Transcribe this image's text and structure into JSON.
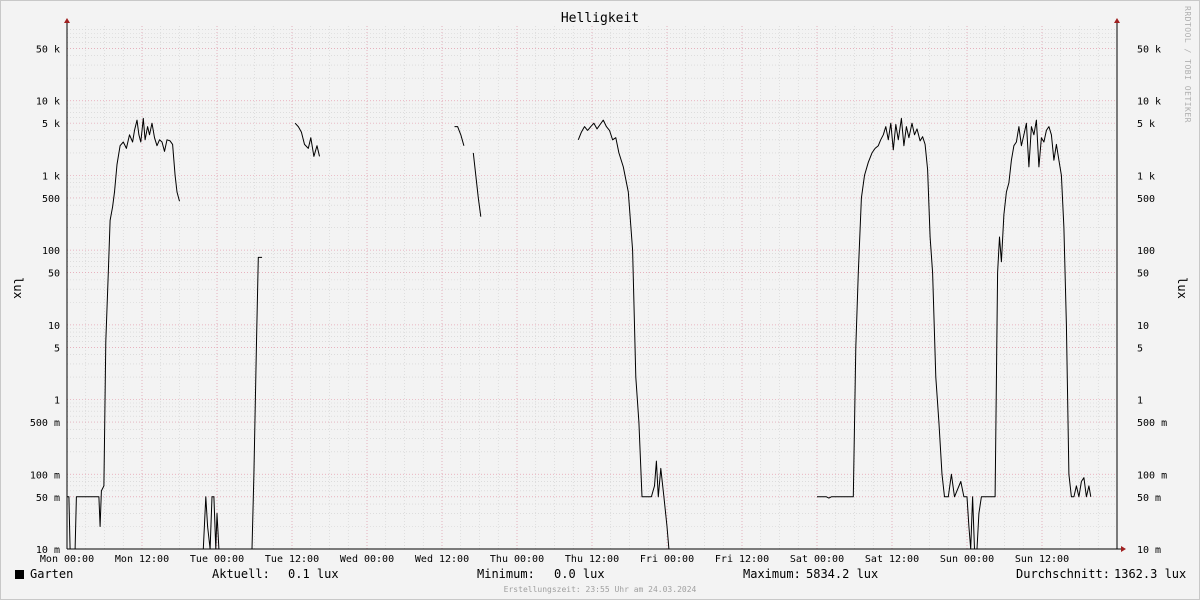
{
  "watermark": "RRDTOOL / TOBI OETIKER",
  "legend": {
    "series_name": "Garten",
    "current_label": "Aktuell:",
    "current_value": "0.1 lux",
    "min_label": "Minimum:",
    "min_value": "0.0 lux",
    "max_label": "Maximum:",
    "max_value": "5834.2 lux",
    "avg_label": "Durchschnitt:",
    "avg_value": "1362.3 lux"
  },
  "footer": "Erstellungszeit: 23:55 Uhr am 24.03.2024",
  "colors": {
    "grid_major": "#e6a0b0",
    "grid_minor": "#d0d0d0",
    "line": "#000000",
    "axis_arrow": "#a02020"
  },
  "chart_data": {
    "type": "line",
    "title": "Helligkeit",
    "ylabel": "lux",
    "ylabel_right": "lux",
    "yscale": "log",
    "ylim": [
      0.01,
      100000
    ],
    "xlim_hours": [
      0,
      168
    ],
    "y_ticks": [
      {
        "value": 0.01,
        "label": "10 m"
      },
      {
        "value": 0.05,
        "label": "50 m"
      },
      {
        "value": 0.1,
        "label": "100 m"
      },
      {
        "value": 0.5,
        "label": "500 m"
      },
      {
        "value": 1,
        "label": "1"
      },
      {
        "value": 5,
        "label": "5"
      },
      {
        "value": 10,
        "label": "10"
      },
      {
        "value": 50,
        "label": "50"
      },
      {
        "value": 100,
        "label": "100"
      },
      {
        "value": 500,
        "label": "500"
      },
      {
        "value": 1000,
        "label": "1 k"
      },
      {
        "value": 5000,
        "label": "5 k"
      },
      {
        "value": 10000,
        "label": "10 k"
      },
      {
        "value": 50000,
        "label": "50 k"
      }
    ],
    "x_ticks": [
      {
        "hour": 0,
        "label": "Mon 00:00"
      },
      {
        "hour": 12,
        "label": "Mon 12:00"
      },
      {
        "hour": 24,
        "label": "Tue 00:00"
      },
      {
        "hour": 36,
        "label": "Tue 12:00"
      },
      {
        "hour": 48,
        "label": "Wed 00:00"
      },
      {
        "hour": 60,
        "label": "Wed 12:00"
      },
      {
        "hour": 72,
        "label": "Thu 00:00"
      },
      {
        "hour": 84,
        "label": "Thu 12:00"
      },
      {
        "hour": 96,
        "label": "Fri 00:00"
      },
      {
        "hour": 108,
        "label": "Fri 12:00"
      },
      {
        "hour": 120,
        "label": "Sat 00:00"
      },
      {
        "hour": 132,
        "label": "Sat 12:00"
      },
      {
        "hour": 144,
        "label": "Sun 00:00"
      },
      {
        "hour": 156,
        "label": "Sun 12:00"
      }
    ],
    "series": [
      {
        "segments": [
          [
            [
              0.0,
              0.05
            ],
            [
              0.3,
              0.05
            ],
            [
              0.5,
              0.01
            ],
            [
              1.3,
              0.01
            ],
            [
              1.5,
              0.05
            ],
            [
              5.1,
              0.05
            ],
            [
              5.3,
              0.02
            ],
            [
              5.5,
              0.06
            ],
            [
              5.9,
              0.07
            ],
            [
              6.2,
              6
            ],
            [
              6.6,
              50
            ],
            [
              6.9,
              250
            ],
            [
              7.3,
              380
            ],
            [
              7.6,
              600
            ],
            [
              8.0,
              1400
            ],
            [
              8.5,
              2500
            ],
            [
              9.0,
              2800
            ],
            [
              9.5,
              2300
            ],
            [
              10.0,
              3500
            ],
            [
              10.5,
              2800
            ],
            [
              10.8,
              4000
            ],
            [
              11.2,
              5500
            ],
            [
              11.5,
              3500
            ],
            [
              11.8,
              2800
            ],
            [
              12.2,
              5800
            ],
            [
              12.5,
              3000
            ],
            [
              12.9,
              4500
            ],
            [
              13.2,
              3500
            ],
            [
              13.6,
              5000
            ],
            [
              14.0,
              3200
            ],
            [
              14.4,
              2500
            ],
            [
              14.8,
              3000
            ],
            [
              15.2,
              2800
            ],
            [
              15.6,
              2100
            ],
            [
              16.0,
              3000
            ],
            [
              16.5,
              2900
            ],
            [
              16.9,
              2600
            ],
            [
              17.3,
              1000
            ],
            [
              17.6,
              600
            ],
            [
              18.0,
              450
            ]
          ],
          [
            [
              21.8,
              0.01
            ],
            [
              22.2,
              0.05
            ],
            [
              22.5,
              0.02
            ],
            [
              22.9,
              0.01
            ],
            [
              23.2,
              0.05
            ],
            [
              23.5,
              0.05
            ],
            [
              23.8,
              0.01
            ],
            [
              24.0,
              0.03
            ],
            [
              24.3,
              0.01
            ],
            [
              29.6,
              0.01
            ],
            [
              29.9,
              0.1
            ],
            [
              30.3,
              5
            ],
            [
              30.6,
              80
            ],
            [
              31.2,
              80
            ]
          ],
          [
            [
              36.5,
              5000
            ],
            [
              37.0,
              4500
            ],
            [
              37.5,
              3800
            ],
            [
              38.0,
              2600
            ],
            [
              38.6,
              2300
            ],
            [
              39.0,
              3200
            ],
            [
              39.5,
              1800
            ],
            [
              40.0,
              2500
            ],
            [
              40.4,
              1800
            ]
          ],
          [
            [
              62.0,
              4500
            ],
            [
              62.5,
              4500
            ],
            [
              63.0,
              3500
            ],
            [
              63.5,
              2500
            ]
          ],
          [
            [
              65.0,
              2000
            ],
            [
              65.4,
              1000
            ],
            [
              65.8,
              500
            ],
            [
              66.2,
              280
            ]
          ],
          [
            [
              81.8,
              3000
            ],
            [
              82.3,
              3800
            ],
            [
              82.8,
              4500
            ],
            [
              83.3,
              4000
            ],
            [
              83.8,
              4500
            ],
            [
              84.3,
              5000
            ],
            [
              84.8,
              4200
            ],
            [
              85.3,
              4800
            ],
            [
              85.8,
              5500
            ],
            [
              86.3,
              4500
            ],
            [
              86.8,
              4000
            ],
            [
              87.3,
              3000
            ],
            [
              87.8,
              3200
            ],
            [
              88.3,
              2000
            ],
            [
              89.0,
              1300
            ],
            [
              89.8,
              600
            ],
            [
              90.5,
              100
            ],
            [
              91.0,
              2
            ],
            [
              91.5,
              0.5
            ],
            [
              92.0,
              0.05
            ],
            [
              93.5,
              0.05
            ],
            [
              94.0,
              0.07
            ],
            [
              94.3,
              0.15
            ],
            [
              94.6,
              0.05
            ],
            [
              95.0,
              0.12
            ],
            [
              95.5,
              0.05
            ],
            [
              96.0,
              0.02
            ],
            [
              96.3,
              0.01
            ]
          ],
          [
            [
              120.0,
              0.05
            ],
            [
              121.5,
              0.05
            ],
            [
              121.9,
              0.048
            ],
            [
              122.3,
              0.05
            ],
            [
              125.8,
              0.05
            ],
            [
              126.2,
              5
            ],
            [
              126.6,
              50
            ],
            [
              127.1,
              500
            ],
            [
              127.6,
              1000
            ],
            [
              128.2,
              1500
            ],
            [
              128.8,
              2000
            ],
            [
              129.3,
              2300
            ],
            [
              129.8,
              2500
            ],
            [
              130.2,
              3000
            ],
            [
              130.6,
              3500
            ],
            [
              131.0,
              4500
            ],
            [
              131.4,
              3000
            ],
            [
              131.8,
              5000
            ],
            [
              132.2,
              2200
            ],
            [
              132.6,
              4800
            ],
            [
              133.0,
              3000
            ],
            [
              133.5,
              5800
            ],
            [
              133.9,
              2500
            ],
            [
              134.3,
              4500
            ],
            [
              134.7,
              3200
            ],
            [
              135.2,
              5000
            ],
            [
              135.6,
              3500
            ],
            [
              136.0,
              4200
            ],
            [
              136.5,
              2900
            ],
            [
              136.9,
              3300
            ],
            [
              137.3,
              2600
            ],
            [
              137.7,
              1200
            ],
            [
              138.1,
              150
            ],
            [
              138.5,
              50
            ],
            [
              139.0,
              2
            ],
            [
              139.5,
              0.5
            ],
            [
              140.0,
              0.1
            ],
            [
              140.4,
              0.05
            ],
            [
              141.0,
              0.05
            ],
            [
              141.5,
              0.1
            ],
            [
              142.0,
              0.05
            ],
            [
              143.0,
              0.08
            ],
            [
              143.5,
              0.05
            ],
            [
              144.0,
              0.05
            ],
            [
              144.3,
              0.02
            ],
            [
              144.6,
              0.01
            ],
            [
              144.9,
              0.05
            ],
            [
              145.2,
              0.01
            ],
            [
              145.6,
              0.01
            ],
            [
              145.9,
              0.03
            ],
            [
              146.3,
              0.05
            ],
            [
              148.5,
              0.05
            ],
            [
              148.9,
              50
            ],
            [
              149.2,
              150
            ],
            [
              149.5,
              70
            ],
            [
              149.9,
              300
            ],
            [
              150.3,
              600
            ],
            [
              150.7,
              800
            ],
            [
              151.1,
              1600
            ],
            [
              151.5,
              2500
            ],
            [
              151.9,
              2800
            ],
            [
              152.3,
              4500
            ],
            [
              152.7,
              2500
            ],
            [
              153.1,
              3500
            ],
            [
              153.5,
              5000
            ],
            [
              153.9,
              1300
            ],
            [
              154.3,
              4500
            ],
            [
              154.7,
              3500
            ],
            [
              155.1,
              5500
            ],
            [
              155.5,
              1300
            ],
            [
              155.9,
              3200
            ],
            [
              156.3,
              2800
            ],
            [
              156.7,
              4000
            ],
            [
              157.1,
              4500
            ],
            [
              157.5,
              3500
            ],
            [
              157.9,
              1600
            ],
            [
              158.3,
              2600
            ],
            [
              158.7,
              1600
            ],
            [
              159.1,
              1000
            ],
            [
              159.5,
              200
            ],
            [
              159.9,
              10
            ],
            [
              160.3,
              0.1
            ],
            [
              160.7,
              0.05
            ],
            [
              161.1,
              0.05
            ],
            [
              161.5,
              0.07
            ],
            [
              161.9,
              0.05
            ],
            [
              162.3,
              0.08
            ],
            [
              162.7,
              0.09
            ],
            [
              163.1,
              0.05
            ],
            [
              163.5,
              0.07
            ],
            [
              163.8,
              0.05
            ]
          ]
        ]
      }
    ]
  }
}
